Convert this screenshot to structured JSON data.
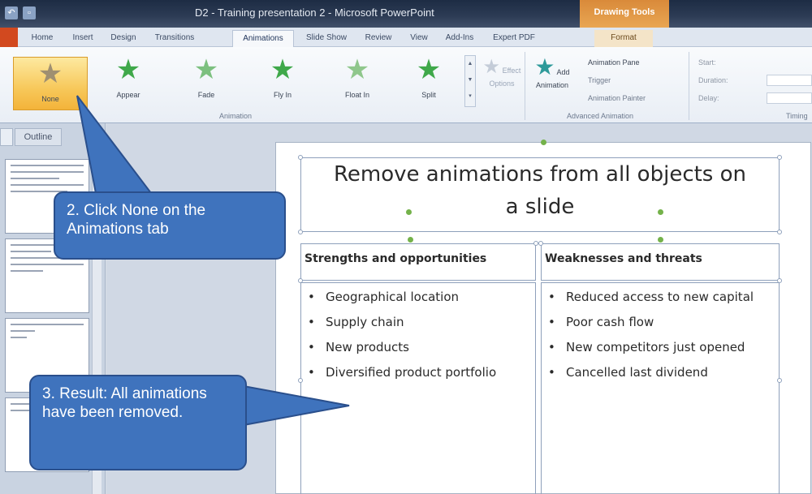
{
  "window": {
    "title": "D2 - Training presentation 2 - Microsoft PowerPoint",
    "context_tab": "Drawing Tools"
  },
  "ribbon_tabs": [
    "Home",
    "Insert",
    "Design",
    "Transitions",
    "Animations",
    "Slide Show",
    "Review",
    "View",
    "Add-Ins",
    "Expert PDF",
    "Format"
  ],
  "active_tab": "Animations",
  "animation_gallery": {
    "items": [
      {
        "label": "None",
        "icon": "star-gray-icon"
      },
      {
        "label": "Appear",
        "icon": "star-green-icon"
      },
      {
        "label": "Fade",
        "icon": "star-green-icon"
      },
      {
        "label": "Fly In",
        "icon": "star-green-icon"
      },
      {
        "label": "Float In",
        "icon": "star-green-icon"
      },
      {
        "label": "Split",
        "icon": "star-green-icon"
      }
    ],
    "group_label": "Animation"
  },
  "effect_options": {
    "label": "Effect Options"
  },
  "advanced_animation": {
    "add_animation": "Add Animation",
    "animation_pane": "Animation Pane",
    "trigger": "Trigger",
    "animation_painter": "Animation Painter",
    "group_label": "Advanced Animation"
  },
  "timing": {
    "start": "Start:",
    "duration": "Duration:",
    "delay": "Delay:",
    "group_label": "Timing"
  },
  "left_pane": {
    "outline_tab": "Outline"
  },
  "slide": {
    "title_line1": "Remove animations from all objects on",
    "title_line2": "a slide",
    "left_header": "Strengths and opportunities",
    "left_bullets": [
      "Geographical location",
      "Supply chain",
      "New products",
      "Diversified product portfolio"
    ],
    "right_header": "Weaknesses and threats",
    "right_bullets": [
      "Reduced access to new capital",
      "Poor cash flow",
      "New competitors just opened",
      "Cancelled last dividend"
    ]
  },
  "callouts": {
    "step2": "2. Click None on the Animations tab",
    "step3": "3. Result: All animations have been removed."
  },
  "colors": {
    "callout": "#3f73bd",
    "selected_button": "#f7c85a",
    "context_tab": "#e9a653"
  }
}
